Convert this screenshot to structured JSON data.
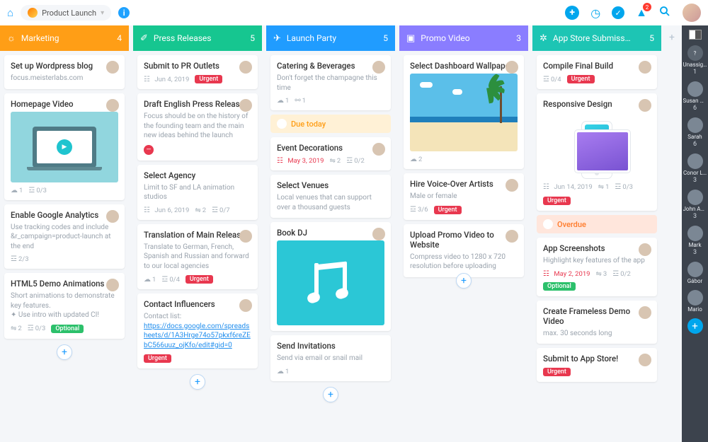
{
  "header": {
    "project_name": "Product Launch",
    "notif_count": "2"
  },
  "columns": [
    {
      "id": "marketing",
      "label": "Marketing",
      "count": "4",
      "color": "marketing",
      "icon": "◴"
    },
    {
      "id": "press",
      "label": "Press Releases",
      "count": "5",
      "color": "press",
      "icon": "�营"
    },
    {
      "id": "party",
      "label": "Launch Party",
      "count": "5",
      "color": "party",
      "icon": "✦"
    },
    {
      "id": "promo",
      "label": "Promo Video",
      "count": "3",
      "color": "promo",
      "icon": "▢"
    },
    {
      "id": "store",
      "label": "App Store Submiss…",
      "count": "5",
      "color": "store",
      "icon": "✿"
    }
  ],
  "cards": {
    "m1": {
      "title": "Set up Wordpress blog",
      "sub": "focus.meisterlabs.com"
    },
    "m2": {
      "title": "Homepage Video"
    },
    "m2m": {
      "c": "1",
      "p": "0/3"
    },
    "m3": {
      "title": "Enable Google Analytics",
      "sub": "Use tracking codes and include &r_campaign=product-launch at the end"
    },
    "m3m": {
      "p": "2/3"
    },
    "m4": {
      "title": "HTML5 Demo Animations",
      "sub": "Short animations to demonstrate key features.",
      "sub2": "✦ Use intro with updated CI!"
    },
    "m4m": {
      "a": "2",
      "p": "0/3",
      "tag": "Optional"
    },
    "p1": {
      "title": "Submit to PR Outlets"
    },
    "p1m": {
      "d": "Jun 4, 2019",
      "tag": "Urgent"
    },
    "p2": {
      "title": "Draft English Press Release",
      "sub": "Focus should be on the history of the founding team and the main new ideas behind the launch"
    },
    "p3": {
      "title": "Select Agency",
      "sub": "Limit to SF and LA animation studios"
    },
    "p3m": {
      "d": "Jun 6, 2019",
      "a": "2",
      "p": "0/7"
    },
    "p4": {
      "title": "Translation of Main Release",
      "sub": "Translate to German, French, Spanish and Russian and forward to our local agencies"
    },
    "p4m": {
      "c": "1",
      "p": "0/4",
      "tag": "Urgent"
    },
    "p5": {
      "title": "Contact Influencers",
      "sub": "Contact list:",
      "link": "https://docs.google.com/spreadsheets/d/1A3Hrge74o57pkxf6reZEbC566uuz_ojKfo/edit#gid=0"
    },
    "p5m": {
      "tag": "Urgent"
    },
    "l1": {
      "title": "Catering & Beverages",
      "sub": "Don't forget the champagne this time"
    },
    "l1m": {
      "c": "1",
      "at": "1"
    },
    "bn_due": "Due today",
    "l2": {
      "title": "Event Decorations"
    },
    "l2m": {
      "d": "May 3, 2019",
      "a": "2",
      "p": "0/2"
    },
    "l3": {
      "title": "Select Venues",
      "sub": "Local venues that can support over a thousand guests"
    },
    "l4": {
      "title": "Book DJ"
    },
    "l5": {
      "title": "Send Invitations",
      "sub": "Send via email or snail mail"
    },
    "l5m": {
      "c": "1"
    },
    "v1": {
      "title": "Select Dashboard Wallpapers"
    },
    "v1m": {
      "c": "2"
    },
    "v2": {
      "title": "Hire Voice-Over Artists",
      "sub": "Male or female"
    },
    "v2m": {
      "p": "3/6",
      "tag": "Urgent"
    },
    "v3": {
      "title": "Upload Promo Video to Website",
      "sub": "Compress video to 1280 x 720 resolution before uploading"
    },
    "s1": {
      "title": "Compile Final Build"
    },
    "s1m": {
      "p": "0/4",
      "tag": "Urgent"
    },
    "s2": {
      "title": "Responsive Design"
    },
    "s2m": {
      "d": "Jun 14, 2019",
      "a": "1",
      "p": "0/3",
      "tag": "Urgent"
    },
    "bn_over": "Overdue",
    "s3": {
      "title": "App Screenshots",
      "sub": "Highlight key features of the app"
    },
    "s3m": {
      "d": "May 2, 2019",
      "a": "3",
      "p": "0/2",
      "tag": "Optional"
    },
    "s4": {
      "title": "Create Frameless Demo Video",
      "sub": "max. 30 seconds long"
    },
    "s5": {
      "title": "Submit to App Store!"
    },
    "s5m": {
      "tag": "Urgent"
    }
  },
  "rail": [
    {
      "name": "Unassig…",
      "count": "1",
      "q": true
    },
    {
      "name": "Susan K…",
      "count": "6"
    },
    {
      "name": "Sarah",
      "count": "6"
    },
    {
      "name": "Conor L…",
      "count": "3"
    },
    {
      "name": "John Ap…",
      "count": "3"
    },
    {
      "name": "Mark",
      "count": "3"
    },
    {
      "name": "Gábor",
      "count": ""
    },
    {
      "name": "Mario",
      "count": ""
    }
  ]
}
